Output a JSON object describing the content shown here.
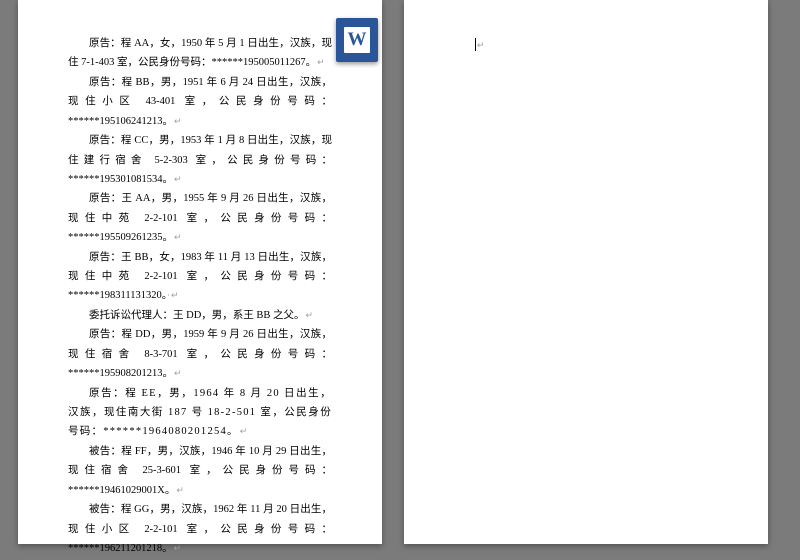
{
  "badge": {
    "letter": "W"
  },
  "doc": {
    "paragraphs": [
      "原告：程 AA，女，1950 年 5 月 1 日出生，汉族，现住 7-1-403 室，公民身份号码：******195005011267。",
      "原告：程 BB，男，1951 年 6 月 24 日出生，汉族，现住小区 43-401 室，公民身份号码：******195106241213。",
      "原告：程 CC，男，1953 年 1 月 8 日出生，汉族，现住建行宿舍 5-2-303 室，公民身份号码：******195301081534。",
      "原告：王 AA，男，1955 年 9 月 26 日出生，汉族，现住中苑 2-2-101 室，公民身份号码：******195509261235。",
      "原告：王 BB，女，1983 年 11 月 13 日出生，汉族，现住中苑 2-2-101 室，公民身份号码：******198311131320。",
      "委托诉讼代理人：王 DD，男，系王 BB 之父。",
      "原告：程 DD，男，1959 年 9 月 26 日出生，汉族，现住宿舍 8-3-701 室，公民身份号码：******195908201213。",
      "原告：程 EE，男，1964 年 8 月 20 日出生，汉族，现住南大街 187 号 18-2-501 室，公民身份号码：******1964080201254。",
      "被告：程 FF，男，汉族，1946 年 10 月 29 日出生，现住宿舍 25-3-601 室，公民身份号码：******19461029001X。",
      "被告：程 GG，男，汉族，1962 年 11 月 20 日出生，现住小区 2-2-101 室，公民身份号码：******196211201218。"
    ]
  }
}
